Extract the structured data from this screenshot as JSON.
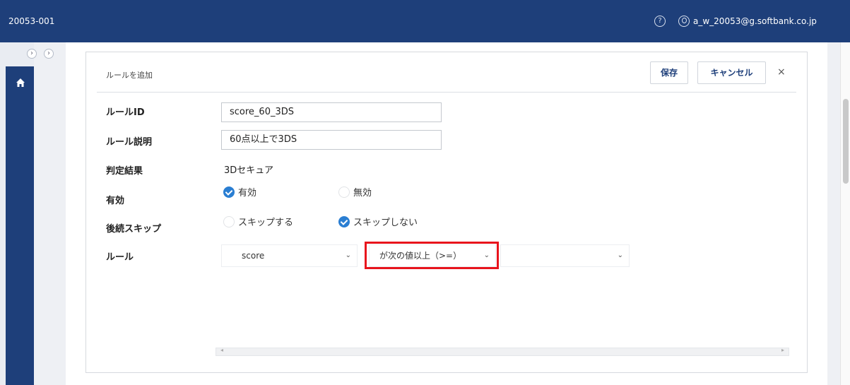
{
  "topbar": {
    "tenant_id": "20053-001",
    "help_glyph": "?",
    "user_email": "a_w_20053@g.softbank.co.jp"
  },
  "nav": {
    "expander_glyph": "›",
    "home_icon": "home-icon"
  },
  "dialog": {
    "title": "ルールを追加",
    "save_label": "保存",
    "cancel_label": "キャンセル",
    "close_glyph": "×"
  },
  "form": {
    "rule_id_label": "ルールID",
    "rule_id_value": "score_60_3DS",
    "rule_desc_label": "ルール説明",
    "rule_desc_value": "60点以上で3DS",
    "result_label": "判定結果",
    "result_value": "3Dセキュア",
    "enabled_label": "有効",
    "enabled_options": [
      "有効",
      "無効"
    ],
    "enabled_selected": "有効",
    "skip_label": "後続スキップ",
    "skip_options": [
      "スキップする",
      "スキップしない"
    ],
    "skip_selected": "スキップしない",
    "rule_label": "ルール",
    "rule_field": "score",
    "rule_operator": "が次の値以上（>=）",
    "rule_value": "",
    "chevron_glyph": "⌄"
  },
  "colors": {
    "header_bg": "#1e3f7a",
    "accent": "#2a7ed2",
    "highlight": "#e8141c"
  }
}
